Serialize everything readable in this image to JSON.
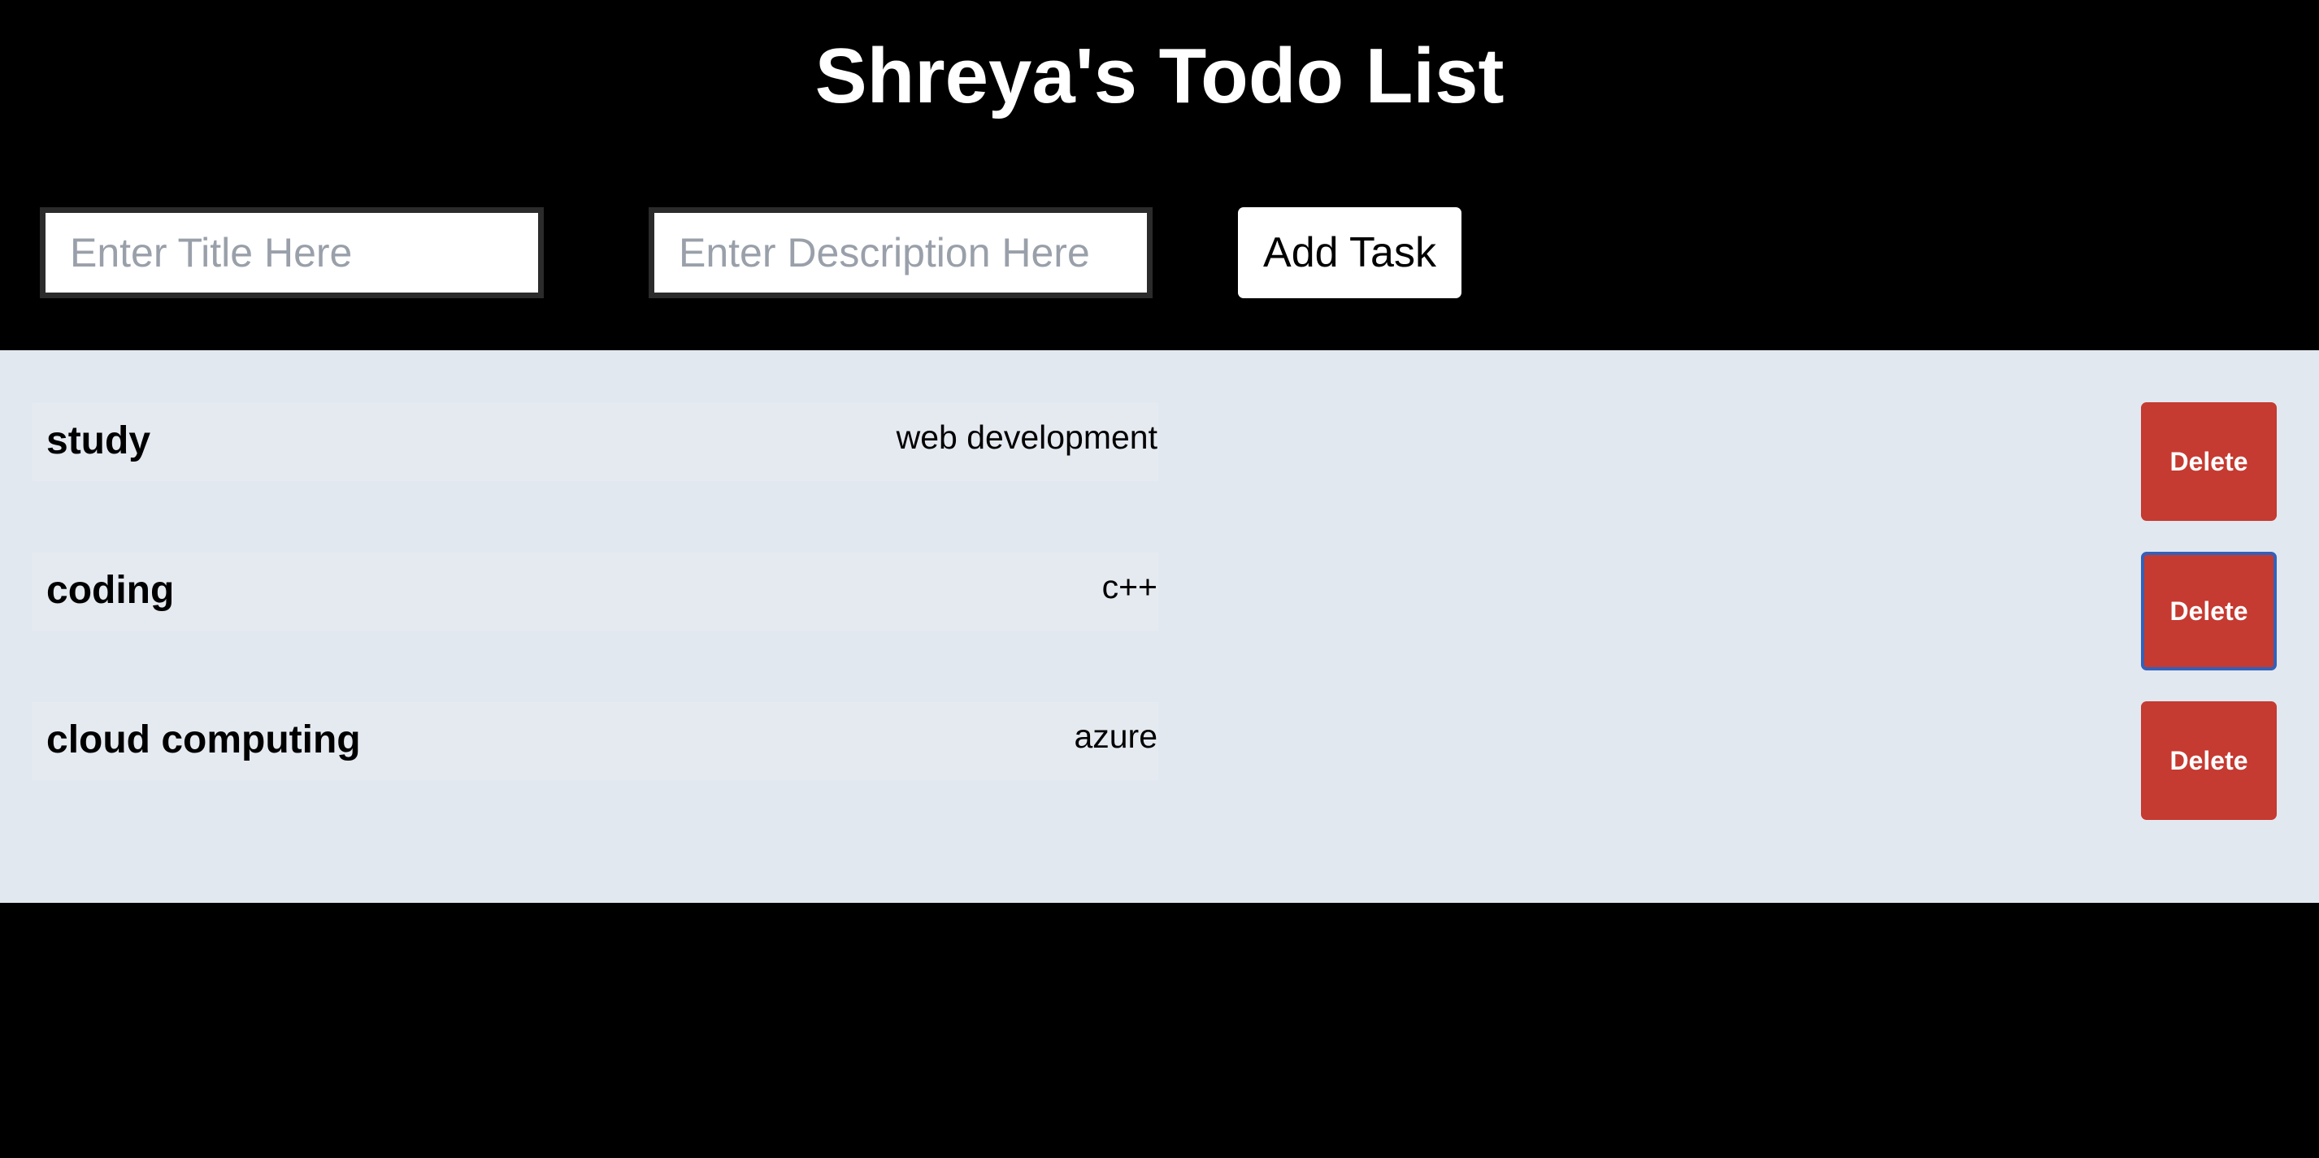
{
  "page": {
    "title": "Shreya's Todo List"
  },
  "form": {
    "title_placeholder": "Enter Title Here",
    "title_value": "",
    "description_placeholder": "Enter Description Here",
    "description_value": "",
    "add_label": "Add Task"
  },
  "tasks": [
    {
      "title": "study",
      "description": "web development",
      "delete_label": "Delete"
    },
    {
      "title": "coding",
      "description": "c++",
      "delete_label": "Delete"
    },
    {
      "title": "cloud computing",
      "description": "azure",
      "delete_label": "Delete"
    }
  ],
  "colors": {
    "background": "#000000",
    "panel": "#e2e8f0",
    "delete": "#c53a31",
    "focus_ring": "#3460b8"
  }
}
